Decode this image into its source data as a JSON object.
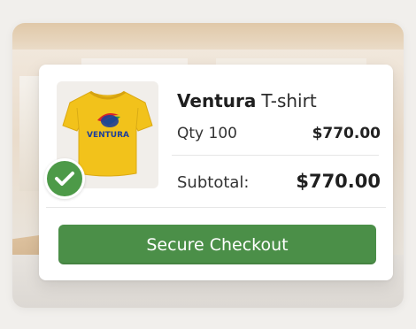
{
  "product": {
    "brand": "Ventura",
    "kind": "T-shirt",
    "image_text": "VENTURA",
    "qty_label": "Qty 100",
    "price": "$770.00"
  },
  "summary": {
    "subtotal_label": "Subtotal:",
    "subtotal_value": "$770.00"
  },
  "actions": {
    "checkout_label": "Secure Checkout"
  },
  "colors": {
    "accent_green": "#4b8f48",
    "tshirt_yellow": "#f2c21b",
    "logo_blue": "#1e3f99",
    "logo_red": "#d8262a",
    "logo_green": "#2c9a47"
  },
  "icons": {
    "badge": "check-icon"
  }
}
